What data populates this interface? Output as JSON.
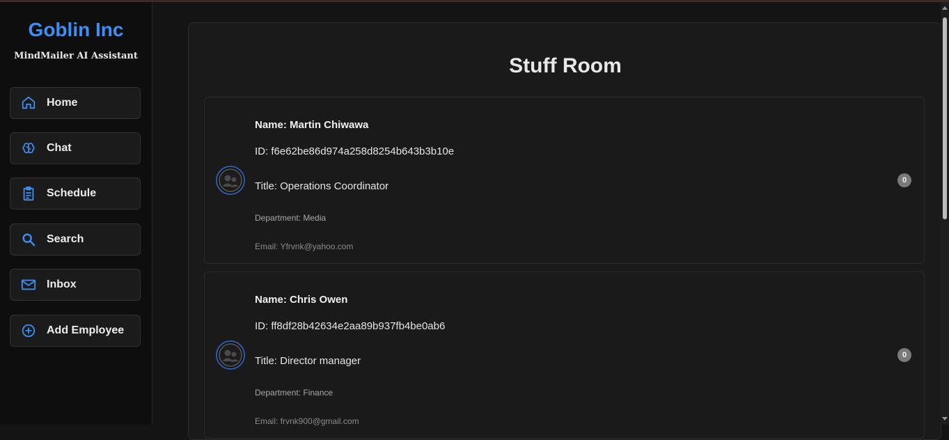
{
  "sidebar": {
    "brand": "Goblin Inc",
    "subtitle": "MindMailer AI Assistant",
    "items": [
      {
        "label": "Home",
        "icon": "home-icon"
      },
      {
        "label": "Chat",
        "icon": "brain-icon"
      },
      {
        "label": "Schedule",
        "icon": "clipboard-icon"
      },
      {
        "label": "Search",
        "icon": "search-icon"
      },
      {
        "label": "Inbox",
        "icon": "mail-icon"
      },
      {
        "label": "Add Employee",
        "icon": "plus-circle-icon"
      }
    ]
  },
  "main": {
    "title": "Stuff Room",
    "employees": [
      {
        "name": "Name: Martin Chiwawa",
        "id": "ID: f6e62be86d974a258d8254b643b3b10e",
        "title": "Title: Operations Coordinator",
        "department": "Department: Media",
        "email": "Email: Yfrvnk@yahoo.com",
        "count": "0"
      },
      {
        "name": "Name: Chris Owen",
        "id": "ID: ff8df28b42634e2aa89b937fb4be0ab6",
        "title": "Title: Director manager",
        "department": "Department: Finance",
        "email": "Email: frvnk900@gmail.com",
        "count": "0"
      }
    ]
  },
  "colors": {
    "accent": "#3b8ff5",
    "background": "#141414",
    "sidebar": "#0e0e0e",
    "card": "#1a1a1a",
    "badge": "#7a7a7a"
  }
}
